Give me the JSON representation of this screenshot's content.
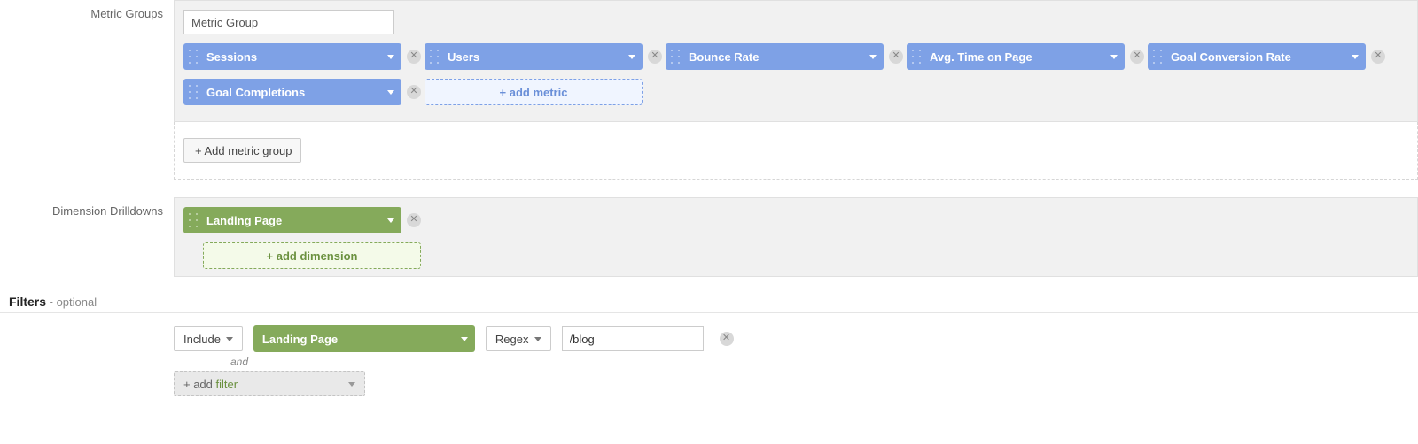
{
  "labels": {
    "metric_groups": "Metric Groups",
    "dimension_drilldowns": "Dimension Drilldowns"
  },
  "metric_group": {
    "name_input": "Metric Group",
    "metrics": [
      {
        "label": "Sessions"
      },
      {
        "label": "Users"
      },
      {
        "label": "Bounce Rate"
      },
      {
        "label": "Avg. Time on Page"
      },
      {
        "label": "Goal Conversion Rate"
      },
      {
        "label": "Goal Completions"
      }
    ],
    "add_metric_label": "+ add metric",
    "add_group_label": "+ Add metric group"
  },
  "dimensions": {
    "items": [
      {
        "label": "Landing Page"
      }
    ],
    "add_dimension_label": "+ add dimension"
  },
  "filters": {
    "heading": "Filters",
    "optional": " - optional",
    "include_label": "Include",
    "dimension": "Landing Page",
    "match_type": "Regex",
    "value": "/blog",
    "and_label": "and",
    "add_filter_prefix": "+ add ",
    "add_filter_word": "filter"
  }
}
